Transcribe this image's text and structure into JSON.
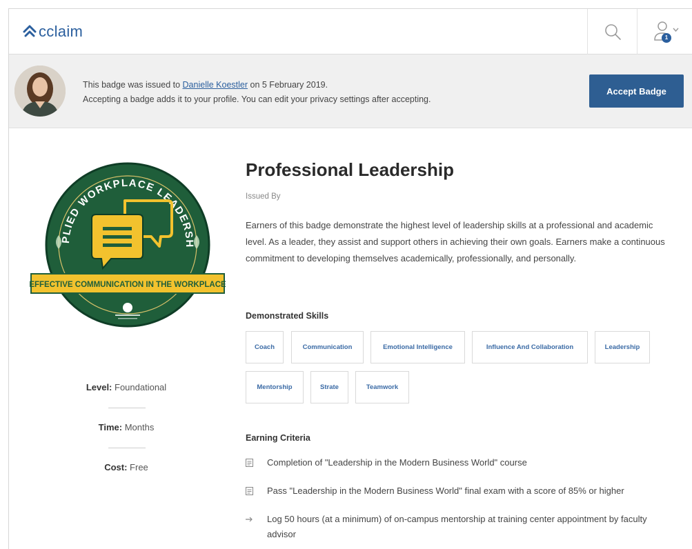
{
  "header": {
    "logo_text": "cclaim",
    "notification_count": "1"
  },
  "notice": {
    "line1_prefix": "This badge was issued to ",
    "recipient_name": "Danielle Koestler",
    "line1_suffix": " on 5 February 2019.",
    "line2": "Accepting a badge adds it to your profile. You can edit your privacy settings after accepting.",
    "accept_label": "Accept Badge"
  },
  "badge_art": {
    "ring_text": "APPLIED WORKPLACE LEADERSHIP",
    "banner_text": "EFFECTIVE COMMUNICATION IN THE WORKPLACE",
    "colors": {
      "green": "#1f5e3a",
      "gold": "#f2c22e",
      "outline": "#0f3d26"
    }
  },
  "meta": {
    "level_label": "Level:",
    "level_value": " Foundational",
    "time_label": "Time:",
    "time_value": " Months",
    "cost_label": "Cost:",
    "cost_value": " Free"
  },
  "badge": {
    "title": "Professional Leadership",
    "issued_by": "Issued By",
    "description": "Earners of this badge demonstrate the highest level of leadership skills at a professional and academic level. As a leader, they assist and support others in achieving their own goals. Earners make a continuous commitment to developing themselves academically, professionally, and personally."
  },
  "skills": {
    "heading": "Demonstrated Skills",
    "items": [
      "Coach",
      "Communication",
      "Emotional Intelligence",
      "Influence And Collaboration",
      "Leadership",
      "Mentorship",
      "Strate",
      "Teamwork"
    ]
  },
  "criteria": {
    "heading": "Earning Criteria",
    "items": [
      "Completion of \"Leadership in the Modern Business World\" course",
      "Pass \"Leadership in the Modern Business World\" final exam with a  score of 85% or higher",
      "Log 50 hours (at a minimum) of on-campus mentorship at training center appointment by faculty advisor"
    ]
  },
  "colors": {
    "brand_blue": "#2b5f9e",
    "button_blue": "#2e5e92",
    "notice_bg": "#f0f0f0"
  }
}
